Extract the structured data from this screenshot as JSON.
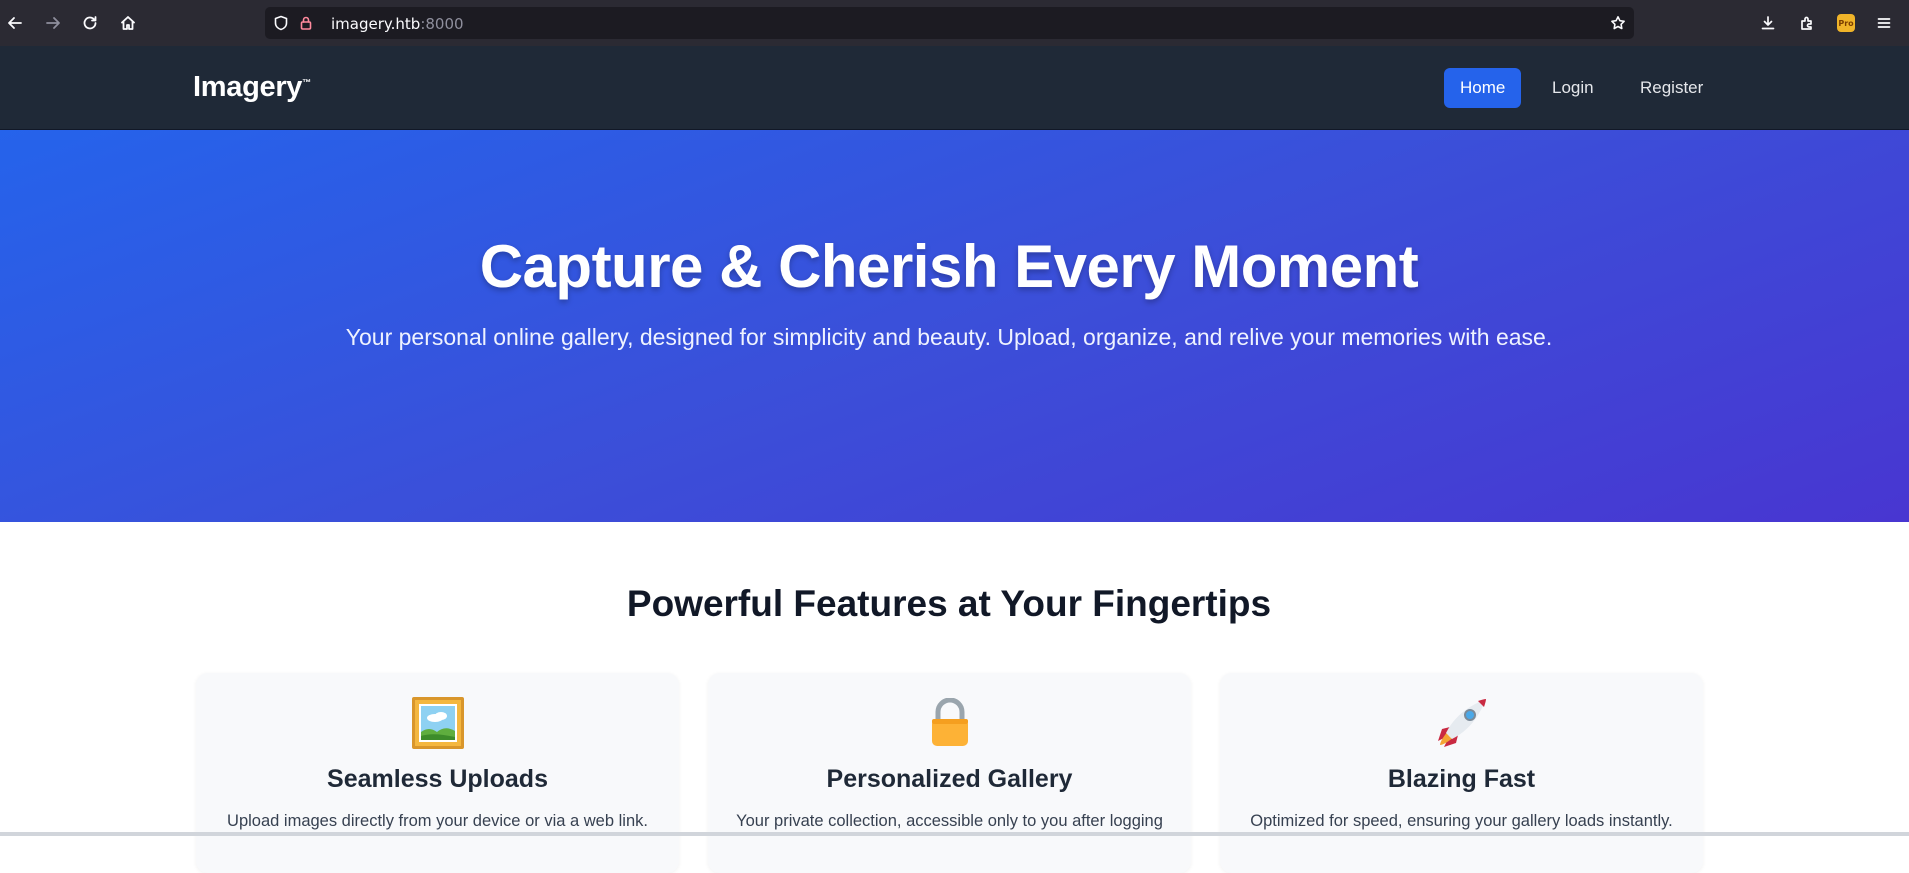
{
  "browser": {
    "url_host": "imagery.htb",
    "url_port": ":8000",
    "extension_badge": "Pro"
  },
  "site": {
    "logo": "Imagery",
    "logo_mark": "™",
    "nav": [
      {
        "label": "Home",
        "active": true
      },
      {
        "label": "Login",
        "active": false
      },
      {
        "label": "Register",
        "active": false
      }
    ]
  },
  "hero": {
    "title": "Capture & Cherish Every Moment",
    "subtitle": "Your personal online gallery, designed for simplicity and beauty. Upload, organize, and relive your memories with ease."
  },
  "features": {
    "title": "Powerful Features at Your Fingertips",
    "cards": [
      {
        "icon": "framed-picture-icon",
        "title": "Seamless Uploads",
        "desc": "Upload images directly from your device or via a web link."
      },
      {
        "icon": "lock-icon",
        "title": "Personalized Gallery",
        "desc": "Your private collection, accessible only to you after logging"
      },
      {
        "icon": "rocket-icon",
        "title": "Blazing Fast",
        "desc": "Optimized for speed, ensuring your gallery loads instantly."
      }
    ]
  },
  "colors": {
    "header_bg": "#1f2937",
    "accent": "#2563eb",
    "hero_gradient_start": "#2563eb",
    "hero_gradient_end": "#4836d1"
  }
}
